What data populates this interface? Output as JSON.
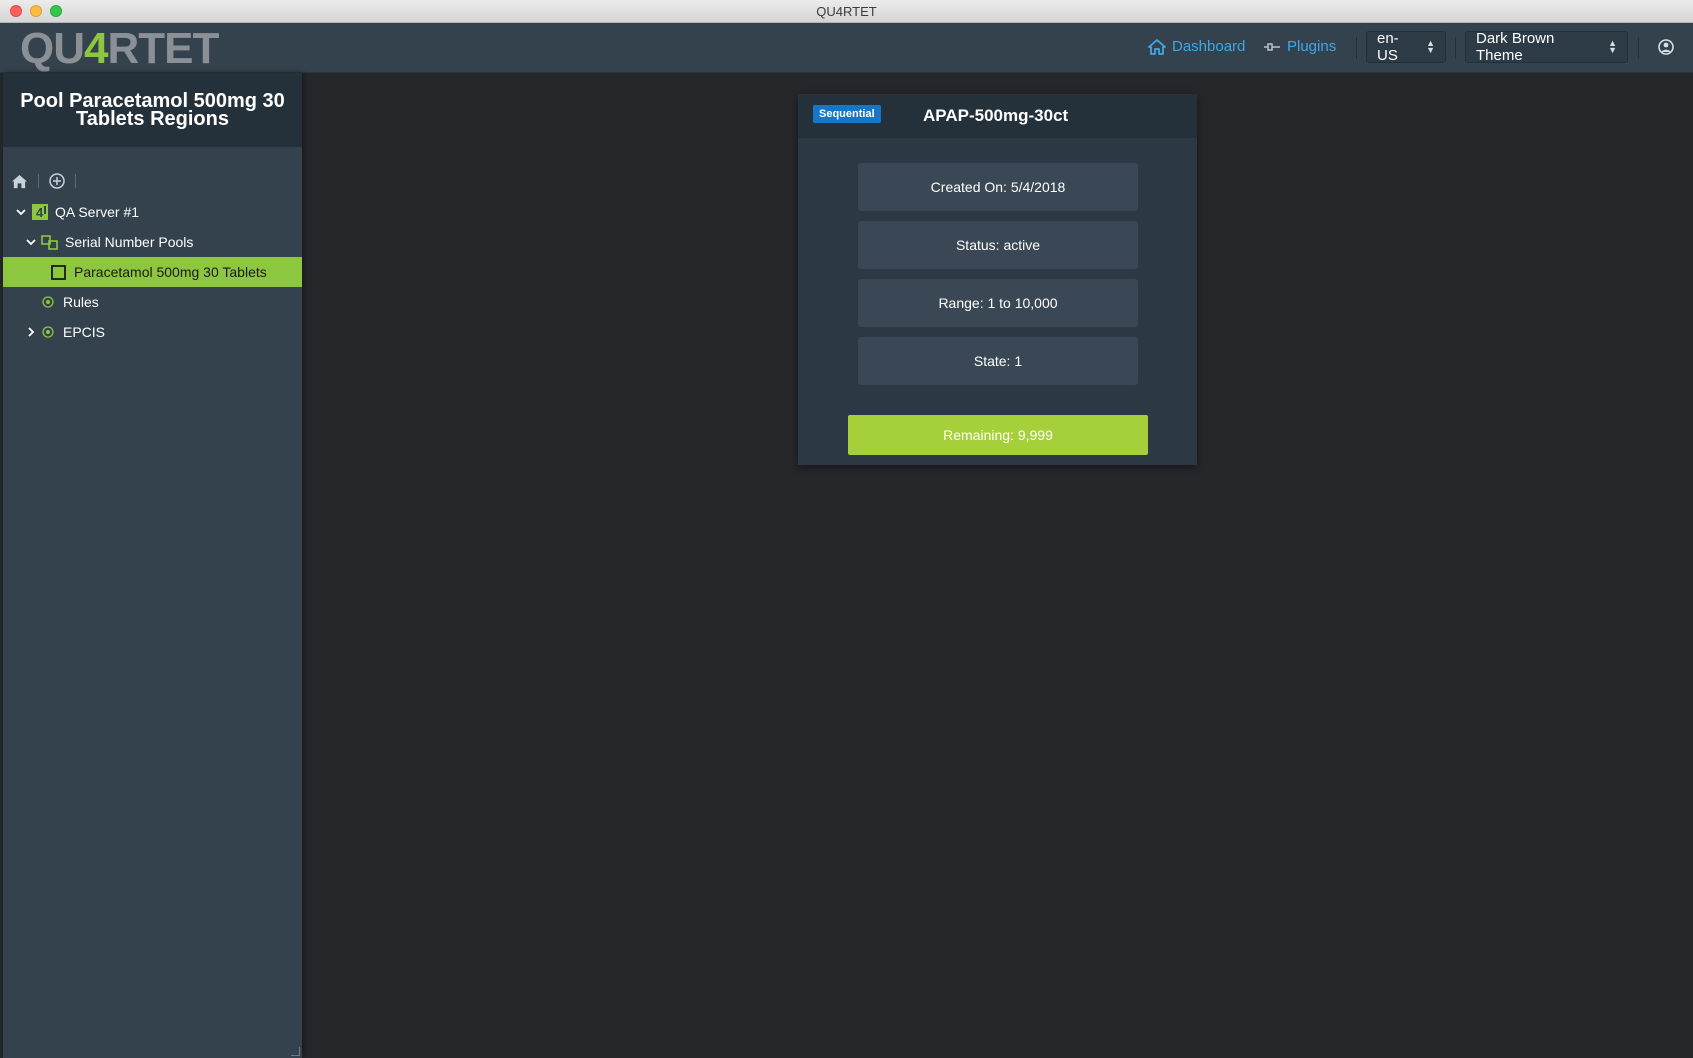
{
  "window": {
    "title": "QU4RTET"
  },
  "header": {
    "logo_left": "QU",
    "logo_four": "4",
    "logo_right": "RTET",
    "dashboard_label": "Dashboard",
    "plugins_label": "Plugins",
    "locale": "en-US",
    "theme": "Dark Brown Theme",
    "accent_color": "#3fa7e8"
  },
  "sidebar": {
    "title": "Pool Paracetamol 500mg 30 Tablets Regions",
    "tree": [
      {
        "label": "QA Server #1",
        "icon": "quartet-server-icon",
        "expanded": true
      },
      {
        "label": "Serial Number Pools",
        "icon": "pools-icon",
        "expanded": true
      },
      {
        "label": "Paracetamol 500mg 30 Tablets",
        "icon": "square-icon",
        "selected": true
      },
      {
        "label": "Rules",
        "icon": "target-icon"
      },
      {
        "label": "EPCIS",
        "icon": "target-icon",
        "expanded": false
      }
    ],
    "selected_color": "#8dc63f"
  },
  "card": {
    "badge": "Sequential",
    "title": "APAP-500mg-30ct",
    "created_on": "Created On: 5/4/2018",
    "status": "Status: active",
    "range": "Range: 1 to 10,000",
    "state": "State: 1",
    "remaining": "Remaining: 9,999",
    "remaining_color": "#a5d03a"
  }
}
